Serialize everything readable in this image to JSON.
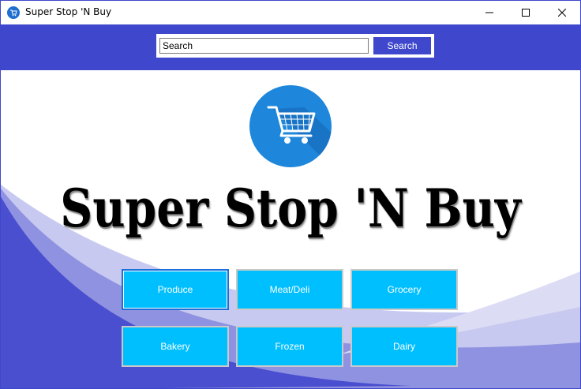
{
  "window": {
    "title": "Super Stop 'N Buy",
    "icon": "cart-icon"
  },
  "controls": {
    "minimize_icon": "minimize-icon",
    "maximize_icon": "maximize-icon",
    "close_icon": "close-icon"
  },
  "search": {
    "value": "Search",
    "button_label": "Search"
  },
  "brand": {
    "title": "Super Stop 'N Buy",
    "logo_icon": "shopping-cart-icon"
  },
  "categories": [
    {
      "label": "Produce"
    },
    {
      "label": "Meat/Deli"
    },
    {
      "label": "Grocery"
    },
    {
      "label": "Bakery"
    },
    {
      "label": "Frozen"
    },
    {
      "label": "Dairy"
    }
  ],
  "colors": {
    "header": "#3f48cc",
    "button": "#00bfff",
    "logo": "#1e87db",
    "wave_light": "#c8c9f0",
    "wave_mid": "#7d80dc"
  }
}
